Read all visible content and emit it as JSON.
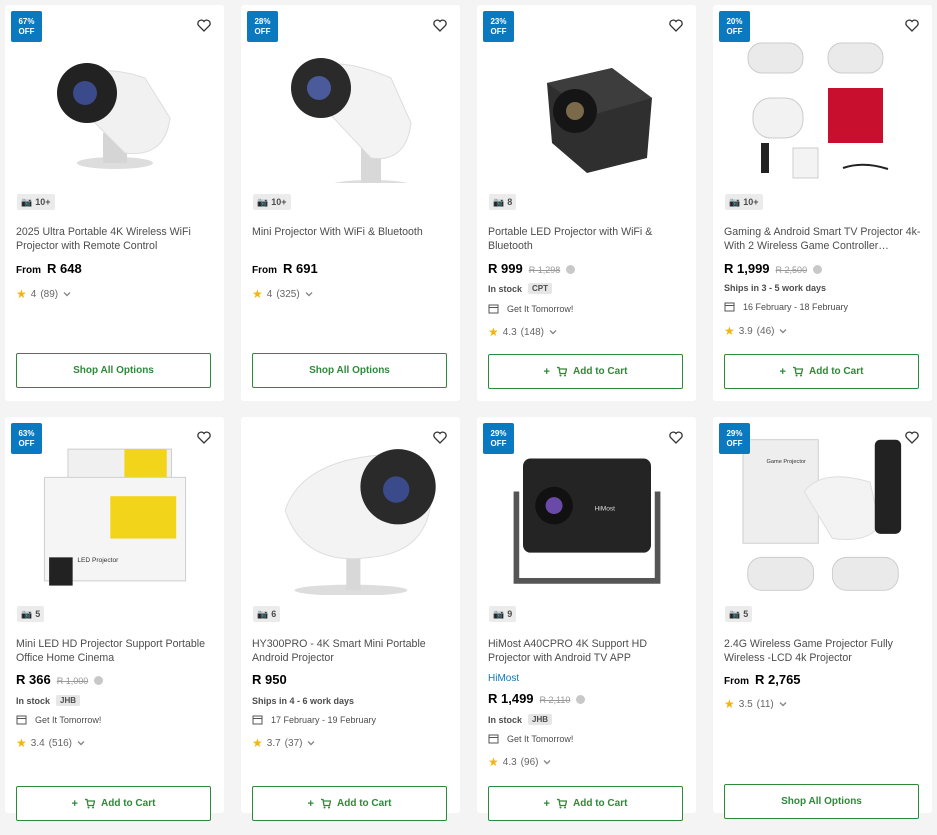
{
  "products": [
    {
      "discount": "67%\nOFF",
      "image_count": "10+",
      "title": "2025 Ultra Portable 4K Wireless WiFi Projector with Remote Control",
      "price_prefix": "From",
      "price": "R 648",
      "rating": "4",
      "reviews": "(89)",
      "button": "Shop All Options"
    },
    {
      "discount": "28%\nOFF",
      "image_count": "10+",
      "title": "Mini Projector With WiFi & Bluetooth",
      "price_prefix": "From",
      "price": "R 691",
      "rating": "4",
      "reviews": "(325)",
      "button": "Shop All Options"
    },
    {
      "discount": "23%\nOFF",
      "image_count": "8",
      "title": "Portable LED Projector with WiFi & Bluetooth",
      "price": "R 999",
      "old_price": "R 1,298",
      "stock": "In stock",
      "stock_tag": "CPT",
      "delivery": "Get It Tomorrow!",
      "rating": "4.3",
      "reviews": "(148)",
      "button": "Add to Cart"
    },
    {
      "discount": "20%\nOFF",
      "image_count": "10+",
      "title": "Gaming & Android Smart TV Projector 4k-With 2 Wireless Game Controller…",
      "price": "R 1,999",
      "old_price": "R 2,500",
      "ships": "Ships in 3 - 5 work days",
      "delivery": "16 February - 18 February",
      "rating": "3.9",
      "reviews": "(46)",
      "button": "Add to Cart"
    },
    {
      "discount": "63%\nOFF",
      "image_count": "5",
      "title": "Mini LED HD Projector Support Portable Office Home Cinema",
      "price": "R 366",
      "old_price": "R 1,000",
      "stock": "In stock",
      "stock_tag": "JHB",
      "delivery": "Get It Tomorrow!",
      "rating": "3.4",
      "reviews": "(516)",
      "button": "Add to Cart"
    },
    {
      "image_count": "6",
      "title": "HY300PRO - 4K Smart Mini Portable Android Projector",
      "price": "R 950",
      "ships": "Ships in 4 - 6 work days",
      "delivery": "17 February - 19 February",
      "rating": "3.7",
      "reviews": "(37)",
      "button": "Add to Cart"
    },
    {
      "discount": "29%\nOFF",
      "image_count": "9",
      "title": "HiMost A40CPRO 4K Support HD Projector with Android TV APP",
      "brand": "HiMost",
      "price": "R 1,499",
      "old_price": "R 2,110",
      "stock": "In stock",
      "stock_tag": "JHB",
      "delivery": "Get It Tomorrow!",
      "rating": "4.3",
      "reviews": "(96)",
      "button": "Add to Cart"
    },
    {
      "discount": "29%\nOFF",
      "image_count": "5",
      "title": "2.4G Wireless Game Projector Fully Wireless -LCD 4k Projector",
      "price_prefix": "From",
      "price": "R 2,765",
      "rating": "3.5",
      "reviews": "(11)",
      "button": "Shop All Options"
    }
  ],
  "product_images": {
    "projector_logo_text": "HiMost",
    "box_label": "Game Projector",
    "yellow_box_label": "LED Projector"
  },
  "colors": {
    "accent": "#0b79bf",
    "button_green": "#2d8a39",
    "star": "#f2b50f"
  },
  "icons": [
    "heart-icon",
    "camera-icon",
    "info-icon",
    "cart-icon",
    "calendar-icon",
    "star-icon",
    "chevron-down-icon"
  ]
}
